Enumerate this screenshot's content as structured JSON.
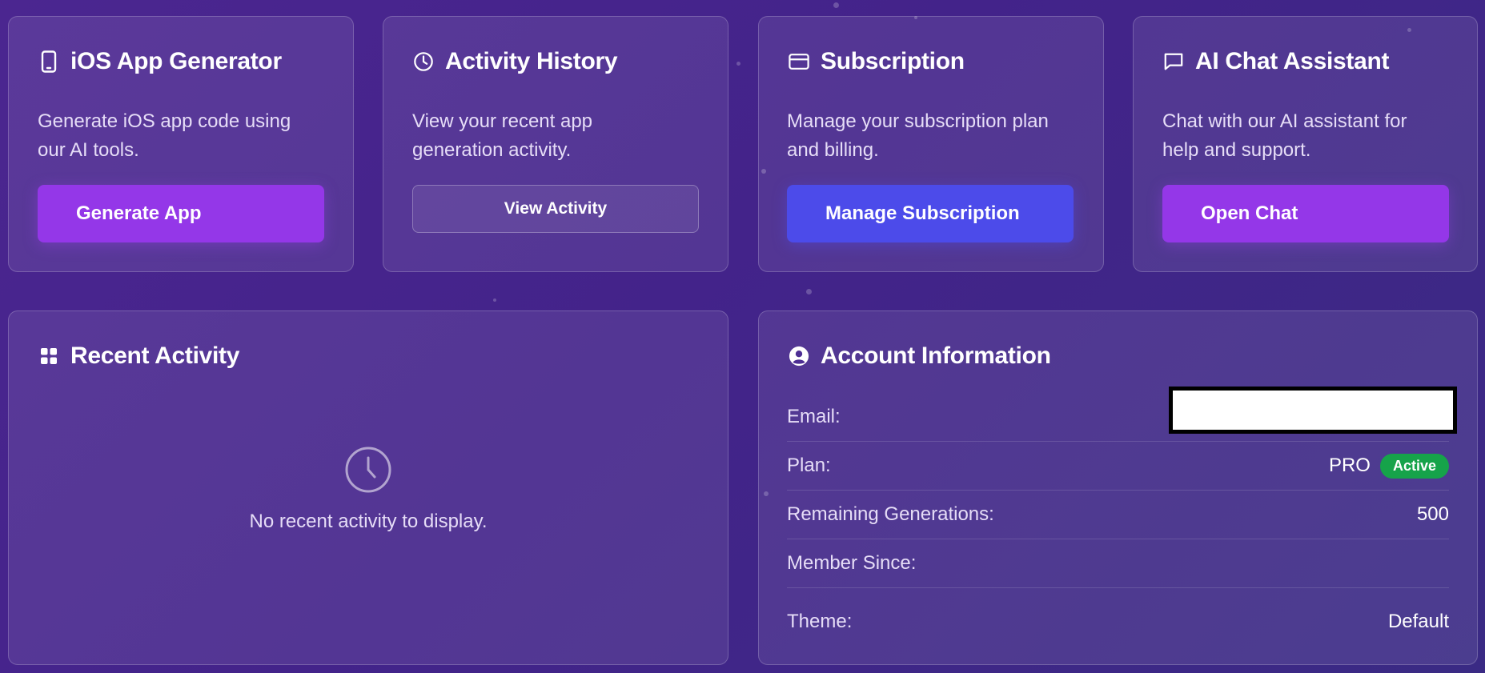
{
  "cards": {
    "ios_generator": {
      "title": "iOS App Generator",
      "description_line1": "Generate iOS app code using",
      "description_line2": "our AI tools.",
      "button_label": "Generate App",
      "icon": "phone-icon"
    },
    "activity_history": {
      "title": "Activity History",
      "description_line1": "View your recent app",
      "description_line2": "generation activity.",
      "button_label": "View Activity",
      "icon": "clock-icon"
    },
    "subscription": {
      "title": "Subscription",
      "description_line1": "Manage your subscription plan",
      "description_line2": "and billing.",
      "button_label": "Manage Subscription",
      "icon": "credit-card-icon"
    },
    "ai_chat": {
      "title": "AI Chat Assistant",
      "description_line1": "Chat with our AI assistant for",
      "description_line2": "help and support.",
      "button_label": "Open Chat",
      "icon": "chat-bubble-icon"
    }
  },
  "recent_activity": {
    "title": "Recent Activity",
    "icon": "grid-icon",
    "empty_icon": "clock-icon",
    "empty_message": "No recent activity to display."
  },
  "account": {
    "title": "Account Information",
    "icon": "user-circle-icon",
    "email_label": "Email:",
    "plan_label": "Plan:",
    "plan_value": "PRO",
    "plan_status": "Active",
    "remaining_label": "Remaining Generations:",
    "remaining_value": "500",
    "member_label": "Member Since:",
    "member_value": "",
    "theme_label": "Theme:",
    "theme_value": "Default"
  },
  "colors": {
    "background": "#44248b",
    "purple_button": "#9437e8",
    "indigo_button": "#4c4bea",
    "active_badge": "#16a34a"
  }
}
